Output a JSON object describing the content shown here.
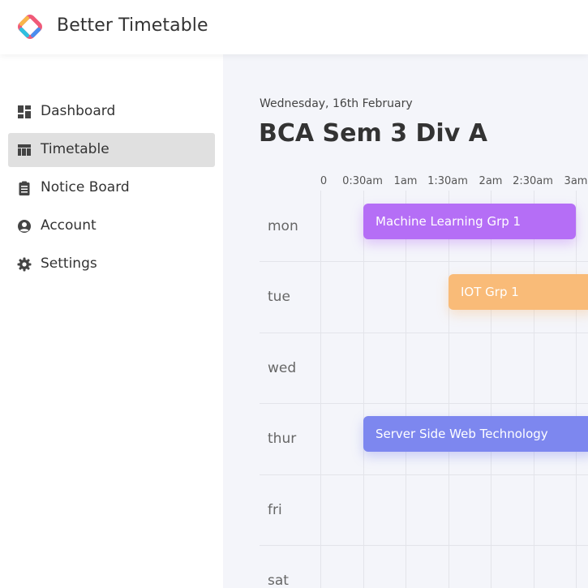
{
  "app": {
    "title": "Better Timetable"
  },
  "sidebar": {
    "items": [
      {
        "label": "Dashboard",
        "icon": "dashboard-icon",
        "active": false
      },
      {
        "label": "Timetable",
        "icon": "table-icon",
        "active": true
      },
      {
        "label": "Notice Board",
        "icon": "clipboard-icon",
        "active": false
      },
      {
        "label": "Account",
        "icon": "account-circle-icon",
        "active": false
      },
      {
        "label": "Settings",
        "icon": "gear-icon",
        "active": false
      }
    ]
  },
  "main": {
    "date": "Wednesday, 16th February",
    "title": "BCA Sem 3 Div A",
    "time_ticks": [
      "0",
      "0:30am",
      "1am",
      "1:30am",
      "2am",
      "2:30am",
      "3am"
    ],
    "days": [
      "mon",
      "tue",
      "wed",
      "thur",
      "fri",
      "sat"
    ],
    "events": [
      {
        "label": "Machine Learning Grp 1",
        "day": "mon",
        "color": "#b56ef6"
      },
      {
        "label": "IOT Grp 1",
        "day": "tue",
        "color": "#f9bb78"
      },
      {
        "label": "Server Side Web Technology",
        "day": "thur",
        "color": "#7d87ef"
      }
    ]
  },
  "colors": {
    "active_nav_bg": "#e0e0e0",
    "main_bg": "#f4f5fa"
  }
}
